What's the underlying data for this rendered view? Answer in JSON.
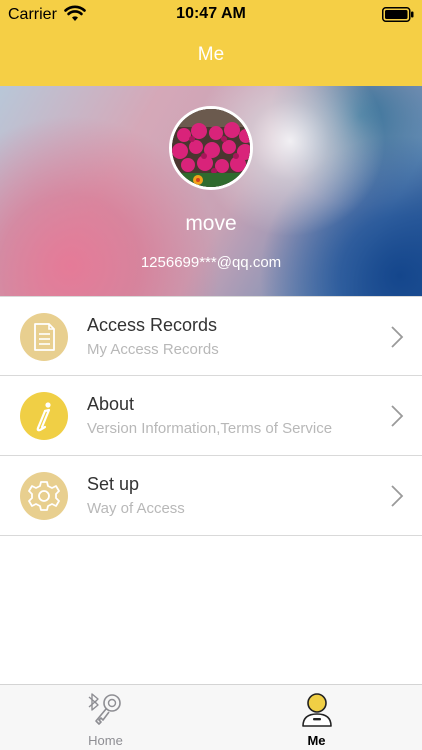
{
  "status_bar": {
    "carrier": "Carrier",
    "time": "10:47 AM"
  },
  "nav": {
    "title": "Me"
  },
  "profile": {
    "username": "move",
    "email": "1256699***@qq.com"
  },
  "menu": [
    {
      "title": "Access Records",
      "subtitle": "My Access Records",
      "icon": "document-icon",
      "icon_bg": "#e8cf8f"
    },
    {
      "title": "About",
      "subtitle": "Version Information,Terms of Service",
      "icon": "info-icon",
      "icon_bg": "#f0cf45"
    },
    {
      "title": "Set up",
      "subtitle": "Way of Access",
      "icon": "gear-icon",
      "icon_bg": "#e8cf8f"
    }
  ],
  "tab_bar": {
    "tabs": [
      {
        "label": "Home",
        "icon": "bluetooth-key-icon",
        "active": false
      },
      {
        "label": "Me",
        "icon": "person-icon",
        "active": true
      }
    ]
  },
  "colors": {
    "accent": "#f5cf45",
    "active_tab": "#000000",
    "inactive_tab": "#8e8e93"
  }
}
